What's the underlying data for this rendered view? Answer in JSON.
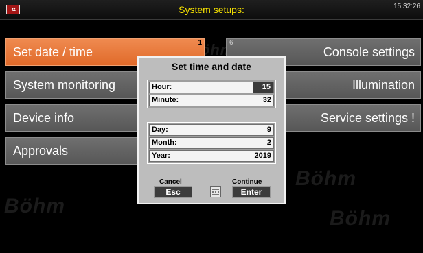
{
  "header": {
    "back_label": "«",
    "title": "System setups:",
    "clock": "15:32:26"
  },
  "watermarks": [
    "Böhm",
    "Böhm",
    "Böhm",
    "Böhm"
  ],
  "menu": {
    "left": [
      {
        "label": "Set date / time",
        "number": "1",
        "active": true
      },
      {
        "label": "System monitoring"
      },
      {
        "label": "Device info"
      },
      {
        "label": "Approvals"
      }
    ],
    "right": [
      {
        "label": "Console settings",
        "number": "6"
      },
      {
        "label": "Illumination"
      },
      {
        "label": "Service settings !"
      }
    ]
  },
  "dialog": {
    "title": "Set time and date",
    "time_fields": [
      {
        "label": "Hour:",
        "value": "15",
        "selected": true
      },
      {
        "label": "Minute:",
        "value": "32"
      }
    ],
    "date_fields": [
      {
        "label": "Day:",
        "value": "9"
      },
      {
        "label": "Month:",
        "value": "2"
      },
      {
        "label": "Year:",
        "value": "2019"
      }
    ],
    "cancel_caption": "Cancel",
    "cancel_key": "Esc",
    "continue_caption": "Continue",
    "continue_key": "Enter",
    "keyboard_icon": "keyboard-icon"
  },
  "colors": {
    "title_yellow": "#f5e000",
    "active_orange": "#e8783c",
    "button_gray": "#646464"
  }
}
